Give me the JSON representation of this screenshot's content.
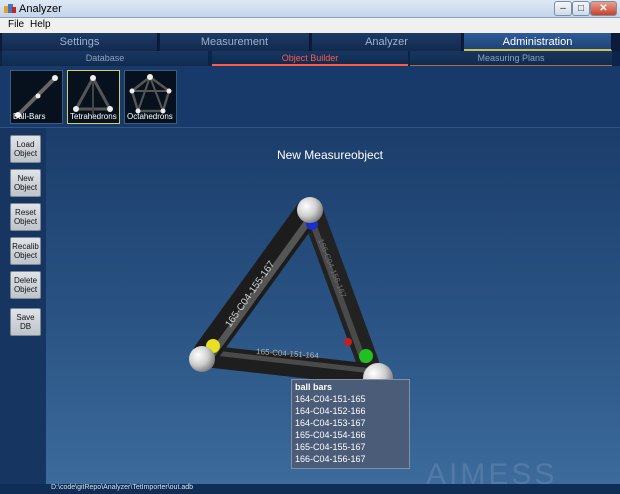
{
  "window": {
    "title": "Analyzer",
    "min": "–",
    "max": "□",
    "close": "✕"
  },
  "menu": {
    "file": "File",
    "help": "Help"
  },
  "main_tabs": {
    "settings": "Settings",
    "measurement": "Measurement",
    "analyzer": "Analyzer",
    "administration": "Administration"
  },
  "sub_tabs": {
    "database": "Database",
    "object_builder": "Object Builder",
    "measuring_plans": "Measuring Plans"
  },
  "library": {
    "ball_bars": "Ball-Bars",
    "tetrahedrons": "Tetrahedrons",
    "octahedrons": "Octahedrons"
  },
  "sidebar": {
    "load": [
      "Load",
      "Object"
    ],
    "new": [
      "New",
      "Object"
    ],
    "reset": [
      "Reset",
      "Object"
    ],
    "recalib": [
      "Recalib",
      "Object"
    ],
    "delete": [
      "Delete",
      "Object"
    ],
    "save": [
      "Save",
      "DB"
    ]
  },
  "viewport": {
    "title": "New Measureobject",
    "bar_labels": {
      "left": "165-C04-155-167",
      "bottom": "165-C04-151-164",
      "right": "166-C04-156-167"
    }
  },
  "tooltip": {
    "title": "ball bars",
    "rows": [
      "164-C04-151-165",
      "164-C04-152-166",
      "164-C04-153-167",
      "165-C04-154-166",
      "165-C04-155-167",
      "166-C04-156-167"
    ]
  },
  "watermark": "AIMESS",
  "status": {
    "path": "D:\\code\\gitRepo\\Analyzer\\TetImporter\\out.adb"
  },
  "colors": {
    "accent_selected": "#ff5a4a",
    "admin_underline": "#d0c050"
  }
}
